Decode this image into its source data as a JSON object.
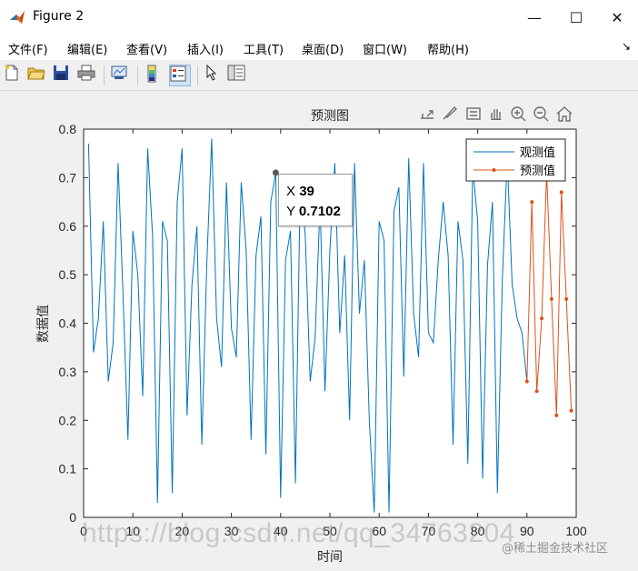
{
  "window": {
    "title": "Figure 2",
    "minimize_glyph": "—",
    "maximize_glyph": "☐",
    "close_glyph": "✕"
  },
  "menu": {
    "items": [
      "文件(F)",
      "编辑(E)",
      "查看(V)",
      "插入(I)",
      "工具(T)",
      "桌面(D)",
      "窗口(W)",
      "帮助(H)"
    ],
    "overflow_glyph": "↘"
  },
  "toolbar": {
    "icons": [
      "new-figure-icon",
      "open-file-icon",
      "save-icon",
      "print-icon",
      "link-plot-icon",
      "insert-colorbar-icon",
      "insert-legend-icon",
      "pointer-icon",
      "property-inspector-icon"
    ]
  },
  "axes_toolbar": {
    "icons": [
      "export-icon",
      "brush-icon",
      "datatip-icon",
      "pan-icon",
      "zoom-in-icon",
      "zoom-out-icon",
      "home-icon"
    ]
  },
  "datatip": {
    "x_label": "X",
    "x_value": "39",
    "y_label": "Y",
    "y_value": "0.7102"
  },
  "watermark": {
    "text": "https://blog.csdn.net/qq_34763204",
    "badge": "@稀土掘金技术社区"
  },
  "chart_data": {
    "type": "line",
    "title": "预测图",
    "xlabel": "时间",
    "ylabel": "数据值",
    "xlim": [
      0,
      100
    ],
    "ylim": [
      0,
      0.8
    ],
    "xticks": [
      "0",
      "10",
      "20",
      "30",
      "40",
      "50",
      "60",
      "70",
      "80",
      "90",
      "100"
    ],
    "yticks": [
      "0",
      "0.1",
      "0.2",
      "0.3",
      "0.4",
      "0.5",
      "0.6",
      "0.7",
      "0.8"
    ],
    "legend": "top-right",
    "colors": {
      "observed": "#0072bd",
      "predicted": "#d95319"
    },
    "series": [
      {
        "name": "观测值",
        "x": [
          1,
          2,
          3,
          4,
          5,
          6,
          7,
          8,
          9,
          10,
          11,
          12,
          13,
          14,
          15,
          16,
          17,
          18,
          19,
          20,
          21,
          22,
          23,
          24,
          25,
          26,
          27,
          28,
          29,
          30,
          31,
          32,
          33,
          34,
          35,
          36,
          37,
          38,
          39,
          40,
          41,
          42,
          43,
          44,
          45,
          46,
          47,
          48,
          49,
          50,
          51,
          52,
          53,
          54,
          55,
          56,
          57,
          58,
          59,
          60,
          61,
          62,
          63,
          64,
          65,
          66,
          67,
          68,
          69,
          70,
          71,
          72,
          73,
          74,
          75,
          76,
          77,
          78,
          79,
          80,
          81,
          82,
          83,
          84,
          85,
          86,
          87,
          88,
          89,
          90
        ],
        "values": [
          0.77,
          0.34,
          0.41,
          0.61,
          0.28,
          0.36,
          0.73,
          0.46,
          0.16,
          0.59,
          0.5,
          0.25,
          0.76,
          0.58,
          0.03,
          0.61,
          0.57,
          0.05,
          0.65,
          0.76,
          0.21,
          0.48,
          0.6,
          0.15,
          0.52,
          0.78,
          0.41,
          0.31,
          0.69,
          0.39,
          0.33,
          0.69,
          0.55,
          0.16,
          0.54,
          0.62,
          0.13,
          0.65,
          0.71,
          0.04,
          0.53,
          0.59,
          0.07,
          0.7,
          0.58,
          0.28,
          0.37,
          0.65,
          0.26,
          0.55,
          0.73,
          0.38,
          0.54,
          0.2,
          0.73,
          0.42,
          0.53,
          0.2,
          0.01,
          0.61,
          0.57,
          0.01,
          0.63,
          0.68,
          0.29,
          0.74,
          0.42,
          0.33,
          0.73,
          0.38,
          0.36,
          0.53,
          0.65,
          0.54,
          0.15,
          0.61,
          0.53,
          0.11,
          0.72,
          0.61,
          0.08,
          0.52,
          0.65,
          0.05,
          0.49,
          0.74,
          0.48,
          0.41,
          0.38,
          0.28
        ]
      },
      {
        "name": "预测值",
        "x": [
          90,
          91,
          92,
          93,
          94,
          95,
          96,
          97,
          98,
          99
        ],
        "values": [
          0.28,
          0.65,
          0.26,
          0.41,
          0.71,
          0.45,
          0.21,
          0.67,
          0.45,
          0.22
        ]
      }
    ]
  }
}
